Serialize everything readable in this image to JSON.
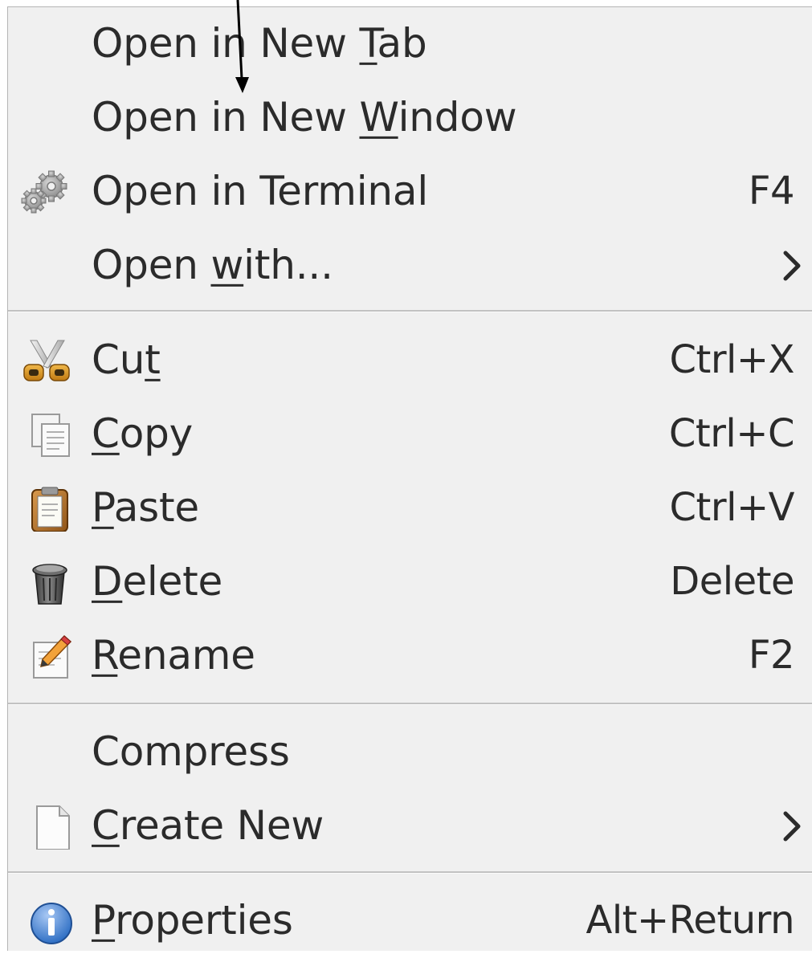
{
  "menu": {
    "items": [
      {
        "id": "open-in-new-tab",
        "pre": "Open in New ",
        "u": "T",
        "post": "ab",
        "shortcut": "",
        "icon": "",
        "submenu": false
      },
      {
        "id": "open-in-new-window",
        "pre": "Open in New ",
        "u": "W",
        "post": "indow",
        "shortcut": "",
        "icon": "",
        "submenu": false
      },
      {
        "id": "open-in-terminal",
        "pre": "Open in Terminal",
        "u": "",
        "post": "",
        "shortcut": "F4",
        "icon": "gears-icon",
        "submenu": false
      },
      {
        "id": "open-with",
        "pre": "Open ",
        "u": "w",
        "post": "ith...",
        "shortcut": "",
        "icon": "",
        "submenu": true
      },
      {
        "id": "cut",
        "pre": "Cu",
        "u": "t",
        "post": "",
        "shortcut": "Ctrl+X",
        "icon": "scissors-icon",
        "submenu": false
      },
      {
        "id": "copy",
        "pre": "",
        "u": "C",
        "post": "opy",
        "shortcut": "Ctrl+C",
        "icon": "copy-icon",
        "submenu": false
      },
      {
        "id": "paste",
        "pre": "",
        "u": "P",
        "post": "aste",
        "shortcut": "Ctrl+V",
        "icon": "clipboard-icon",
        "submenu": false
      },
      {
        "id": "delete",
        "pre": "",
        "u": "D",
        "post": "elete",
        "shortcut": "Delete",
        "icon": "trash-icon",
        "submenu": false
      },
      {
        "id": "rename",
        "pre": "",
        "u": "R",
        "post": "ename",
        "shortcut": "F2",
        "icon": "rename-icon",
        "submenu": false
      },
      {
        "id": "compress",
        "pre": "Compress",
        "u": "",
        "post": "",
        "shortcut": "",
        "icon": "",
        "submenu": false
      },
      {
        "id": "create-new",
        "pre": "",
        "u": "C",
        "post": "reate New",
        "shortcut": "",
        "icon": "document-icon",
        "submenu": true
      },
      {
        "id": "properties",
        "pre": "",
        "u": "P",
        "post": "roperties",
        "shortcut": "Alt+Return",
        "icon": "info-icon",
        "submenu": false
      }
    ]
  },
  "colors": {
    "menu_background": "#f0f0f0",
    "text": "#2b2b2b",
    "separator": "#c2c2c2",
    "annotation_arrow": "#000000"
  },
  "annotation": {
    "icon": "arrow-annotation-icon"
  }
}
